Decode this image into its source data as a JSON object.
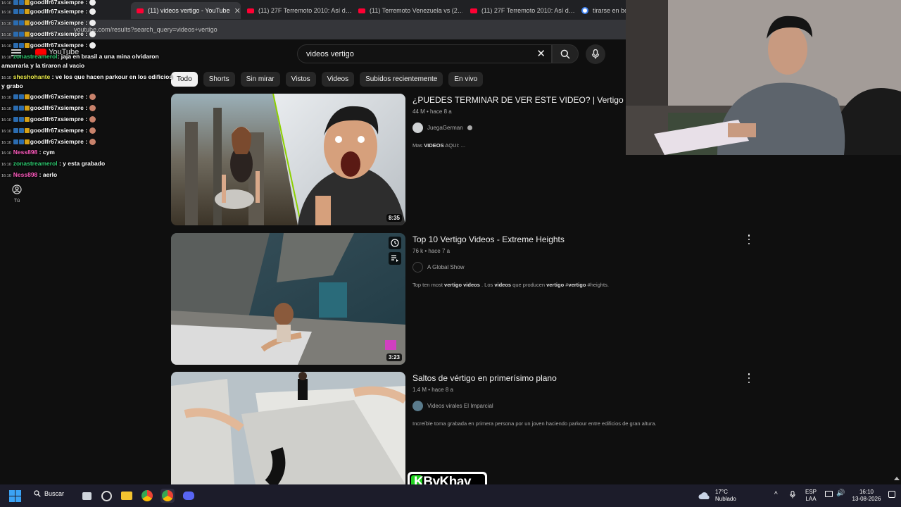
{
  "browser": {
    "tabs": [
      {
        "label": "(11) videos vertigo - YouTube",
        "active": true
      },
      {
        "label": "(11) 27F Terremoto 2010: Así d…",
        "active": false
      },
      {
        "label": "(11) Terremoto Venezuela vs (2…",
        "active": false
      },
      {
        "label": "(11) 27F Terremoto 2010: Así d…",
        "active": false
      },
      {
        "label": "tirarse en ber",
        "active": false
      }
    ],
    "url": "youtube.com/results?search_query=videos+vertigo"
  },
  "youtube": {
    "logo_text": "YouTube",
    "search": {
      "query": "videos vertigo"
    },
    "chips": [
      "Todo",
      "Shorts",
      "Sin mirar",
      "Vistos",
      "Videos",
      "Subidos recientemente",
      "En vivo"
    ],
    "guide": {
      "you_label": "Tú"
    },
    "results": [
      {
        "title": "¿PUEDES TERMINAR DE VER ESTE VIDEO? | Vertigo Test",
        "meta": "44 M • hace 8 a",
        "channel": "JuegaGerman",
        "verified": true,
        "desc_pre": "Mas ",
        "desc_bold": "VIDEOS",
        "desc_post": " AQUI: ...",
        "duration": "8:35"
      },
      {
        "title": "Top 10 Vertigo Videos - Extreme Heights",
        "meta": "76 k • hace 7 a",
        "channel": "A Global Show",
        "verified": false,
        "desc_parts": [
          "Top ten most ",
          "vertigo videos",
          " . Los ",
          "videos",
          " que producen ",
          "vertigo",
          " #",
          "vertigo",
          " #heights."
        ],
        "duration": "3:23"
      },
      {
        "title": "Saltos de vértigo en primerísimo plano",
        "meta": "1.4 M • hace 8 a",
        "channel": "Videos virales El Imparcial",
        "verified": false,
        "desc": "Increíble toma grabada en primera persona por un joven haciendo parkour entre edificios de gran altura."
      }
    ]
  },
  "chat": [
    {
      "time": "16:10",
      "user": "goodlfr67xsiempre",
      "msg": ":",
      "color": "white"
    },
    {
      "time": "16:10",
      "user": "goodlfr67xsiempre",
      "msg": ":",
      "color": "white"
    },
    {
      "time": "16:10",
      "user": "goodlfr67xsiempre",
      "msg": ":",
      "color": "white"
    },
    {
      "time": "16:10",
      "user": "goodlfr67xsiempre",
      "msg": ":",
      "color": "white"
    },
    {
      "time": "16:10",
      "user": "goodlfr67xsiempre",
      "msg": ":",
      "color": "white"
    },
    {
      "time": "16:10",
      "user": "zonastreamerol",
      "msg": ": jaja en brasil a una mina olvidaron",
      "color": "green"
    },
    {
      "time": "",
      "user": "",
      "msg": "amarrarla y la tiraron al vacio",
      "color": "white"
    },
    {
      "time": "16:10",
      "user": "sheshohante",
      "msg": ": ve los que hacen parkour en los edificios",
      "color": "yellow"
    },
    {
      "time": "",
      "user": "",
      "msg": "y grabo",
      "color": "white"
    },
    {
      "time": "16:10",
      "user": "goodlfr67xsiempre",
      "msg": ":",
      "color": "white"
    },
    {
      "time": "16:10",
      "user": "goodlfr67xsiempre",
      "msg": ":",
      "color": "white"
    },
    {
      "time": "16:10",
      "user": "goodlfr67xsiempre",
      "msg": ":",
      "color": "white"
    },
    {
      "time": "16:10",
      "user": "goodlfr67xsiempre",
      "msg": ":",
      "color": "white"
    },
    {
      "time": "16:10",
      "user": "goodlfr67xsiempre",
      "msg": ":",
      "color": "white"
    },
    {
      "time": "16:10",
      "user": "Ness898",
      "msg": ": cym",
      "color": "pink"
    },
    {
      "time": "16:10",
      "user": "zonastreamerol",
      "msg": ": y esta grabado",
      "color": "green"
    },
    {
      "time": "16:10",
      "user": "Ness898",
      "msg": ": aerlo",
      "color": "pink"
    }
  ],
  "watermark": "KByKhay",
  "taskbar": {
    "search_label": "Buscar",
    "weather_temp": "17°C",
    "weather_desc": "Nublado",
    "lang_top": "ESP",
    "lang_bottom": "LAA",
    "time": "16:10",
    "date": "13-08-2026"
  },
  "colors": {
    "bg": "#0f0f0f",
    "accent": "#ff0000",
    "chip_active": "#f1f1f1"
  }
}
